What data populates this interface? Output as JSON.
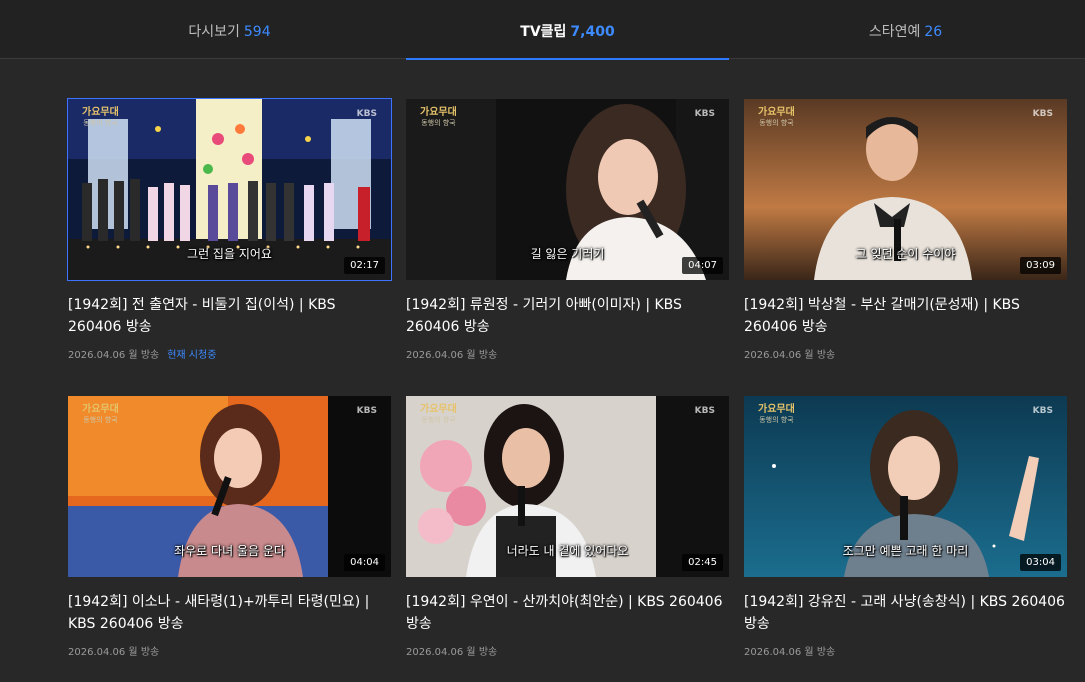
{
  "tabs": [
    {
      "label": "다시보기",
      "count": "594"
    },
    {
      "label": "TV클립",
      "count": "7,400"
    },
    {
      "label": "스타연예",
      "count": "26"
    }
  ],
  "videos": [
    {
      "title": "[1942회] 전 출연자 - 비둘기 집(이석) | KBS 260406 방송",
      "date": "2026.04.06 월 방송",
      "now_playing": "현재 시청중",
      "duration": "02:17",
      "subtitle": "그런 집을 지어요",
      "broadcaster": "KBS"
    },
    {
      "title": "[1942회] 류원정 - 기러기 아빠(이미자) | KBS 260406 방송",
      "date": "2026.04.06 월 방송",
      "duration": "04:07",
      "subtitle": "길 잃은 기러기",
      "broadcaster": "KBS"
    },
    {
      "title": "[1942회] 박상철 - 부산 갈매기(문성재) | KBS 260406 방송",
      "date": "2026.04.06 월 방송",
      "duration": "03:09",
      "subtitle": "그 잊던 순이 수이야",
      "broadcaster": "KBS"
    },
    {
      "title": "[1942회] 이소나 - 새타령(1)+까투리 타령(민요) | KBS 260406 방송",
      "date": "2026.04.06 월 방송",
      "duration": "04:04",
      "subtitle": "좌우로 다녀 울음 운다",
      "broadcaster": "KBS"
    },
    {
      "title": "[1942회] 우연이 - 산까치야(최안순) | KBS 260406 방송",
      "date": "2026.04.06 월 방송",
      "duration": "02:45",
      "subtitle": "너라도 내 곁에 있어다오",
      "broadcaster": "KBS"
    },
    {
      "title": "[1942회] 강유진 - 고래 사냥(송창식) | KBS 260406 방송",
      "date": "2026.04.06 월 방송",
      "duration": "03:04",
      "subtitle": "조그만 예쁜 고래 한 마리",
      "broadcaster": "KBS"
    }
  ],
  "show_logo": {
    "main": "가요무대",
    "sub": "동행의 향국"
  },
  "colors": {
    "accent": "#3d8bff",
    "background": "#282828",
    "tab_bar": "#222222",
    "selected_outline": "#3d73ff"
  }
}
